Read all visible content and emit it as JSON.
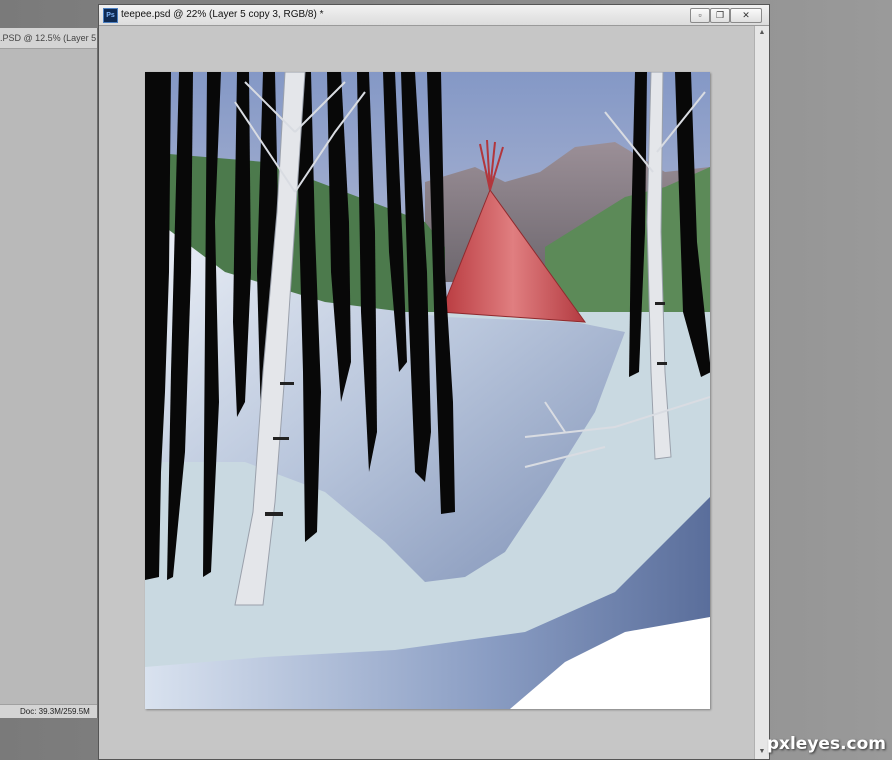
{
  "left_window": {
    "tab_title": ".PSD @ 12.5% (Layer 5",
    "status": "Doc: 39.3M/259.5M"
  },
  "main_window": {
    "app_icon": "Ps",
    "title": "teepee.psd @ 22% (Layer 5 copy 3, RGB/8) *",
    "controls": {
      "minimize_icon": "minimize-icon",
      "restore_icon": "restore-icon",
      "close_icon": "close-icon"
    }
  },
  "watermark": "pxleyes.com",
  "colors": {
    "sky": "#8fa3cc",
    "teepee": "#c94a4d",
    "snow": "#d7e0ec",
    "tree_black": "#0a0a0a",
    "tree_birch": "#e8eaee"
  }
}
